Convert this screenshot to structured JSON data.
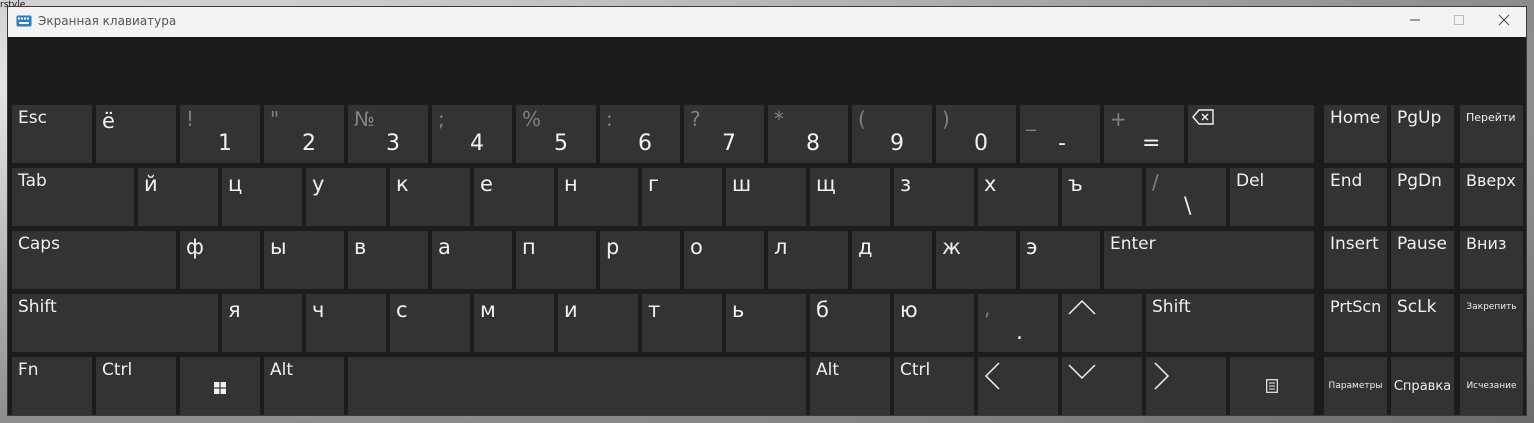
{
  "window": {
    "title": "Экранная клавиатура",
    "top_fragment": "rstyle..."
  },
  "rows": {
    "row1": [
      {
        "label": "Esc"
      },
      {
        "label": "ё"
      },
      {
        "top": "!",
        "main": "1"
      },
      {
        "top": "\"",
        "main": "2"
      },
      {
        "top": "№",
        "main": "3"
      },
      {
        "top": ";",
        "main": "4"
      },
      {
        "top": "%",
        "main": "5"
      },
      {
        "top": ":",
        "main": "6"
      },
      {
        "top": "?",
        "main": "7"
      },
      {
        "top": "*",
        "main": "8"
      },
      {
        "top": "(",
        "main": "9"
      },
      {
        "top": ")",
        "main": "0"
      },
      {
        "top": "_",
        "main": "-"
      },
      {
        "top": "+",
        "main": "="
      }
    ],
    "row2": [
      "Tab",
      "й",
      "ц",
      "у",
      "к",
      "е",
      "н",
      "г",
      "ш",
      "щ",
      "з",
      "х",
      "ъ"
    ],
    "row2_backslash": {
      "top": "/",
      "main": "\\"
    },
    "row2_del": "Del",
    "row3": [
      "Caps",
      "ф",
      "ы",
      "в",
      "а",
      "п",
      "р",
      "о",
      "л",
      "д",
      "ж",
      "э",
      "Enter"
    ],
    "row4": [
      "Shift",
      "я",
      "ч",
      "с",
      "м",
      "и",
      "т",
      "ь",
      "б",
      "ю"
    ],
    "row4_comma": {
      "top": ",",
      "main": "."
    },
    "row4_rshift": "Shift",
    "row5": {
      "fn": "Fn",
      "ctrl": "Ctrl",
      "alt": "Alt",
      "alt_r": "Alt",
      "ctrl_r": "Ctrl"
    }
  },
  "nav": {
    "home": "Home",
    "pgup": "PgUp",
    "goto": "Перейти",
    "end": "End",
    "pgdn": "PgDn",
    "up": "Вверх",
    "insert": "Insert",
    "pause": "Pause",
    "down": "Вниз",
    "prtscn": "PrtScn",
    "sclk": "ScLk",
    "pin": "Закрепить",
    "options": "Параметры",
    "help": "Справка",
    "fade": "Исчезание"
  },
  "icons": [
    "keyboard-app-icon",
    "backspace-icon",
    "windows-icon",
    "arrow-up-icon",
    "arrow-down-icon",
    "arrow-left-icon",
    "arrow-right-icon",
    "context-menu-icon",
    "minimize-icon",
    "maximize-icon",
    "close-icon"
  ],
  "colors": {
    "key": "#333333",
    "background": "#1c1c1c",
    "titlebar": "#f3f3f3"
  }
}
